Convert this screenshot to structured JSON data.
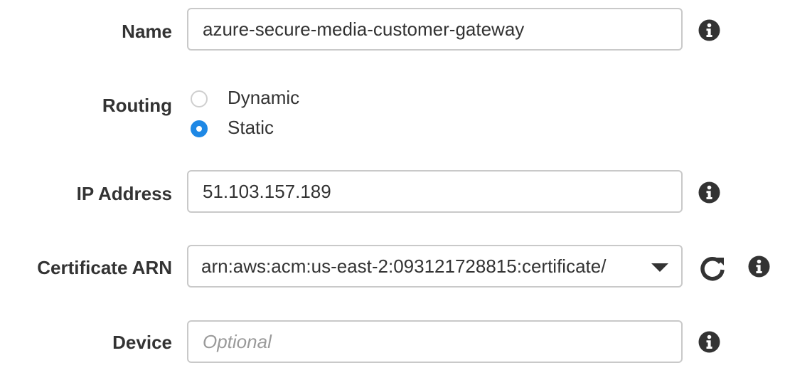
{
  "form": {
    "name": {
      "label": "Name",
      "value": "azure-secure-media-customer-gateway"
    },
    "routing": {
      "label": "Routing",
      "options": [
        {
          "label": "Dynamic",
          "selected": false
        },
        {
          "label": "Static",
          "selected": true
        }
      ]
    },
    "ip_address": {
      "label": "IP Address",
      "value": "51.103.157.189"
    },
    "certificate_arn": {
      "label": "Certificate ARN",
      "selected": "arn:aws:acm:us-east-2:093121728815:certificate/"
    },
    "device": {
      "label": "Device",
      "value": "",
      "placeholder": "Optional"
    }
  },
  "icons": {
    "info": "info-icon",
    "refresh": "refresh-icon",
    "dropdown": "chevron-down-icon"
  },
  "colors": {
    "accent": "#1e88e5",
    "text": "#333333",
    "border": "#c9c9c9",
    "placeholder": "#9a9a9a"
  }
}
